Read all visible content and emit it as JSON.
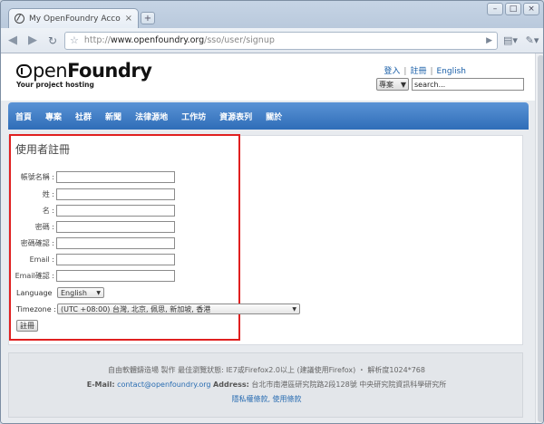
{
  "browser": {
    "tab_title": "My OpenFoundry Account",
    "tab_close": "×",
    "newtab": "+",
    "url_prefix": "http://",
    "url_host": "www.openfoundry.org",
    "url_path": "/sso/user/signup",
    "window_controls": [
      "–",
      "□",
      "×"
    ]
  },
  "site": {
    "logo_prefix": "pen",
    "logo_bold": "Foundry",
    "tagline": "Your project hosting",
    "header_links": [
      "登入",
      "註冊",
      "English"
    ],
    "search_scope": "專案",
    "search_placeholder": "search...",
    "nav": [
      "首頁",
      "專案",
      "社群",
      "新聞",
      "法律源地",
      "工作坊",
      "資源表列",
      "關於"
    ]
  },
  "form": {
    "title": "使用者註冊",
    "fields": [
      {
        "label": "帳號名稱 :",
        "value": ""
      },
      {
        "label": "姓 :",
        "value": ""
      },
      {
        "label": "名 :",
        "value": ""
      },
      {
        "label": "密碼 :",
        "value": ""
      },
      {
        "label": "密碼確認 :",
        "value": ""
      },
      {
        "label": "Email :",
        "value": ""
      },
      {
        "label": "Email確認 :",
        "value": ""
      }
    ],
    "language_label": "Language",
    "language_value": "English",
    "timezone_label": "Timezone :",
    "timezone_value": "(UTC +08:00) 台灣, 北京, 佩思, 新加坡, 香港",
    "submit_label": "註冊"
  },
  "footer": {
    "line1": "自由軟體鑄造場 製作 最佳瀏覽狀態: IE7或Firefox2.0以上 (建議使用Firefox) ・ 解析度1024*768",
    "email_label": "E-Mail:",
    "email": "contact@openfoundry.org",
    "address_label": "Address:",
    "address": "台北市南港區研究院路2段128號 中央研究院資訊科學研究所",
    "links": "隱私權條款, 使用條款"
  }
}
